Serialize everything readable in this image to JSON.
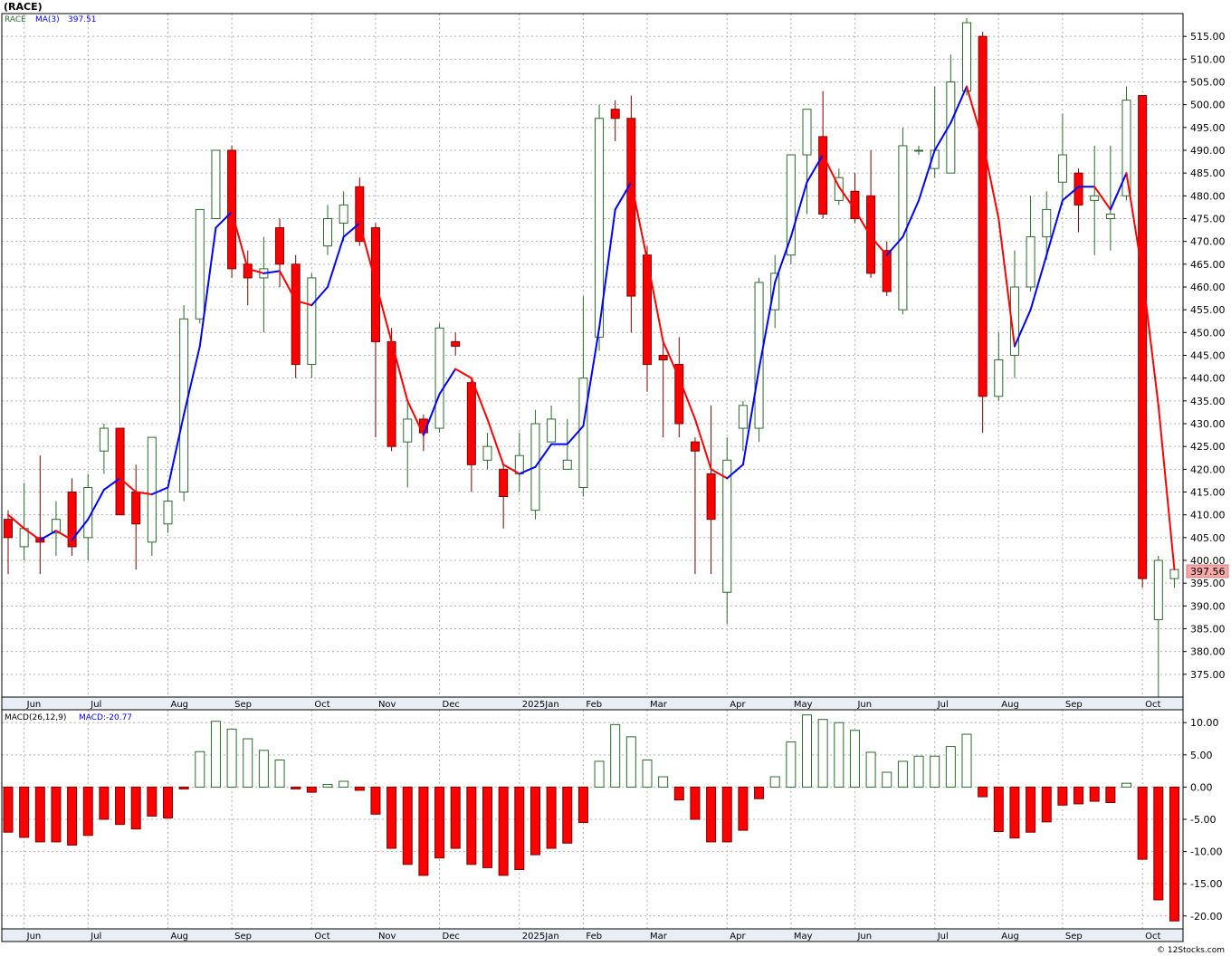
{
  "header": {
    "symbol_title": "(RACE)",
    "legend_price_name": "RACE",
    "legend_ma_name": "MA(3)",
    "legend_ma_value": "397.51",
    "last_price_label": "397.56",
    "macd_name": "MACD(26,12,9)",
    "macd_value_label": "MACD:-20.77",
    "credit": "© 12Stocks.com"
  },
  "colors": {
    "up_candle": "#2d6a2d",
    "down_candle": "#ff0000",
    "ma_up": "#0000ff",
    "ma_down": "#ff0000",
    "grid": "#b0b0b0",
    "price_badge": "#f4a8a8"
  },
  "chart_data": [
    {
      "type": "candlestick",
      "series_name": "RACE",
      "interval": "weekly",
      "ylim": [
        370,
        520
      ],
      "y_ticks": [
        375,
        380,
        385,
        390,
        395,
        400,
        405,
        410,
        415,
        420,
        425,
        430,
        435,
        440,
        445,
        450,
        455,
        460,
        465,
        470,
        475,
        480,
        485,
        490,
        495,
        500,
        505,
        510,
        515
      ],
      "x_month_labels": [
        "Jun",
        "Jul",
        "Aug",
        "Sep",
        "Oct",
        "Nov",
        "Dec",
        "2025Jan",
        "Feb",
        "Mar",
        "Apr",
        "May",
        "Jun",
        "Jul",
        "Aug",
        "Sep",
        "Oct"
      ],
      "x_month_index": [
        1,
        5,
        10,
        14,
        19,
        23,
        27,
        32,
        36,
        40,
        45,
        49,
        53,
        58,
        62,
        66,
        71
      ],
      "candles": [
        {
          "o": 409,
          "h": 411,
          "l": 397,
          "c": 405
        },
        {
          "o": 403,
          "h": 417,
          "l": 400,
          "c": 407
        },
        {
          "o": 405,
          "h": 423,
          "l": 397,
          "c": 404
        },
        {
          "o": 406,
          "h": 413,
          "l": 401,
          "c": 409
        },
        {
          "o": 415,
          "h": 418,
          "l": 401,
          "c": 403
        },
        {
          "o": 405,
          "h": 419,
          "l": 400,
          "c": 416
        },
        {
          "o": 424,
          "h": 430,
          "l": 419,
          "c": 429
        },
        {
          "o": 429,
          "h": 429,
          "l": 410,
          "c": 410
        },
        {
          "o": 415,
          "h": 421,
          "l": 398,
          "c": 408
        },
        {
          "o": 404,
          "h": 427,
          "l": 401,
          "c": 427
        },
        {
          "o": 408,
          "h": 416,
          "l": 406,
          "c": 413
        },
        {
          "o": 415,
          "h": 456,
          "l": 413,
          "c": 453
        },
        {
          "o": 453,
          "h": 477,
          "l": 452,
          "c": 477
        },
        {
          "o": 475,
          "h": 490,
          "l": 475,
          "c": 490
        },
        {
          "o": 490,
          "h": 491,
          "l": 462,
          "c": 464
        },
        {
          "o": 465,
          "h": 468,
          "l": 456,
          "c": 462
        },
        {
          "o": 462,
          "h": 471,
          "l": 450,
          "c": 464
        },
        {
          "o": 473,
          "h": 475,
          "l": 460,
          "c": 465
        },
        {
          "o": 465,
          "h": 467,
          "l": 440,
          "c": 443
        },
        {
          "o": 443,
          "h": 463,
          "l": 440,
          "c": 462
        },
        {
          "o": 469,
          "h": 478,
          "l": 467,
          "c": 475
        },
        {
          "o": 474,
          "h": 481,
          "l": 470,
          "c": 478
        },
        {
          "o": 482,
          "h": 484,
          "l": 469,
          "c": 470
        },
        {
          "o": 473,
          "h": 474,
          "l": 427,
          "c": 448
        },
        {
          "o": 448,
          "h": 451,
          "l": 424,
          "c": 425
        },
        {
          "o": 426,
          "h": 435,
          "l": 416,
          "c": 431
        },
        {
          "o": 431,
          "h": 432,
          "l": 424,
          "c": 428
        },
        {
          "o": 429,
          "h": 452,
          "l": 428,
          "c": 451
        },
        {
          "o": 448,
          "h": 450,
          "l": 445,
          "c": 447
        },
        {
          "o": 439,
          "h": 440,
          "l": 415,
          "c": 421
        },
        {
          "o": 422,
          "h": 428,
          "l": 420,
          "c": 425
        },
        {
          "o": 420,
          "h": 421,
          "l": 407,
          "c": 414
        },
        {
          "o": 419,
          "h": 428,
          "l": 415,
          "c": 423
        },
        {
          "o": 411,
          "h": 433,
          "l": 409,
          "c": 430
        },
        {
          "o": 426,
          "h": 434,
          "l": 426,
          "c": 431
        },
        {
          "o": 420,
          "h": 431,
          "l": 420,
          "c": 422
        },
        {
          "o": 416,
          "h": 458,
          "l": 414,
          "c": 440
        },
        {
          "o": 449,
          "h": 500,
          "l": 446,
          "c": 497
        },
        {
          "o": 499,
          "h": 501,
          "l": 492,
          "c": 497
        },
        {
          "o": 497,
          "h": 502,
          "l": 450,
          "c": 458
        },
        {
          "o": 467,
          "h": 469,
          "l": 437,
          "c": 443
        },
        {
          "o": 445,
          "h": 448,
          "l": 427,
          "c": 444
        },
        {
          "o": 443,
          "h": 449,
          "l": 427,
          "c": 430
        },
        {
          "o": 426,
          "h": 427,
          "l": 397,
          "c": 424
        },
        {
          "o": 419,
          "h": 434,
          "l": 397,
          "c": 409
        },
        {
          "o": 393,
          "h": 427,
          "l": 386,
          "c": 422
        },
        {
          "o": 429,
          "h": 435,
          "l": 424,
          "c": 434
        },
        {
          "o": 429,
          "h": 462,
          "l": 426,
          "c": 461
        },
        {
          "o": 455,
          "h": 467,
          "l": 451,
          "c": 463
        },
        {
          "o": 467,
          "h": 489,
          "l": 465,
          "c": 489
        },
        {
          "o": 489,
          "h": 499,
          "l": 476,
          "c": 499
        },
        {
          "o": 493,
          "h": 503,
          "l": 475,
          "c": 476
        },
        {
          "o": 479,
          "h": 486,
          "l": 478,
          "c": 484
        },
        {
          "o": 481,
          "h": 485,
          "l": 474,
          "c": 475
        },
        {
          "o": 480,
          "h": 490,
          "l": 462,
          "c": 463
        },
        {
          "o": 468,
          "h": 470,
          "l": 458,
          "c": 459
        },
        {
          "o": 455,
          "h": 495,
          "l": 454,
          "c": 491
        },
        {
          "o": 490,
          "h": 491,
          "l": 489,
          "c": 490
        },
        {
          "o": 486,
          "h": 504,
          "l": 484,
          "c": 490
        },
        {
          "o": 485,
          "h": 511,
          "l": 485,
          "c": 505
        },
        {
          "o": 503,
          "h": 519,
          "l": 502,
          "c": 518
        },
        {
          "o": 515,
          "h": 516,
          "l": 428,
          "c": 436
        },
        {
          "o": 436,
          "h": 450,
          "l": 435,
          "c": 444
        },
        {
          "o": 445,
          "h": 468,
          "l": 440,
          "c": 460
        },
        {
          "o": 460,
          "h": 480,
          "l": 459,
          "c": 471
        },
        {
          "o": 471,
          "h": 481,
          "l": 466,
          "c": 477
        },
        {
          "o": 483,
          "h": 498,
          "l": 478,
          "c": 489
        },
        {
          "o": 485,
          "h": 486,
          "l": 472,
          "c": 478
        },
        {
          "o": 479,
          "h": 491,
          "l": 467,
          "c": 480
        },
        {
          "o": 475,
          "h": 491,
          "l": 468,
          "c": 476
        },
        {
          "o": 480,
          "h": 504,
          "l": 479,
          "c": 501
        },
        {
          "o": 502,
          "h": 502,
          "l": 394,
          "c": 396
        },
        {
          "o": 387,
          "h": 401,
          "l": 370,
          "c": 400
        },
        {
          "o": 396,
          "h": 399,
          "l": 394,
          "c": 398
        }
      ],
      "ma3": [
        410,
        407,
        404.5,
        406.5,
        404.5,
        409,
        415.5,
        418,
        415,
        414.5,
        416,
        432,
        447,
        473,
        476.5,
        464,
        463,
        463.5,
        457,
        456,
        460,
        471,
        474,
        461,
        448,
        435,
        427.5,
        436.5,
        442,
        440,
        431,
        421,
        419,
        420.5,
        425.5,
        425.5,
        429.5,
        451,
        477,
        483,
        466,
        448,
        440,
        431,
        420,
        418,
        421,
        442,
        461,
        471,
        483,
        489,
        482,
        477,
        471,
        467,
        471,
        479,
        490,
        496,
        504,
        492,
        475,
        447,
        455,
        467,
        479,
        482,
        482,
        477,
        485,
        463,
        434,
        398
      ]
    },
    {
      "type": "bar",
      "series_name": "MACD(26,12,9)",
      "ylim": [
        -22,
        12
      ],
      "y_ticks": [
        -20,
        -15,
        -10,
        -5,
        0,
        5,
        10
      ],
      "y_tick_labels": [
        "-20.00",
        "-15.00",
        "-10.00",
        "-5.00",
        "0.00",
        "5.00",
        "10.00"
      ],
      "values": [
        -7,
        -7.8,
        -8.5,
        -8.5,
        -9,
        -7.5,
        -5,
        -5.8,
        -6.5,
        -4.5,
        -4.8,
        -0.3,
        5.5,
        10.2,
        9,
        7.5,
        5.7,
        4.2,
        -0.3,
        -0.8,
        0.4,
        0.9,
        -0.5,
        -4.2,
        -9.5,
        -12,
        -13.7,
        -11,
        -9.5,
        -12,
        -12.5,
        -13.7,
        -12.8,
        -10.5,
        -9.5,
        -8.7,
        -5.5,
        4,
        9.7,
        7.8,
        4.2,
        1.6,
        -2,
        -5,
        -8.5,
        -8.5,
        -6.7,
        -1.8,
        1.6,
        7,
        11.2,
        10.5,
        10,
        8.8,
        5.4,
        2.3,
        4,
        4.8,
        4.8,
        6.3,
        8.2,
        -1.5,
        -6.9,
        -7.9,
        -7,
        -5.4,
        -2.8,
        -2.6,
        -2.2,
        -2.4,
        0.6,
        -11.2,
        -17.5,
        -20.77
      ]
    }
  ]
}
